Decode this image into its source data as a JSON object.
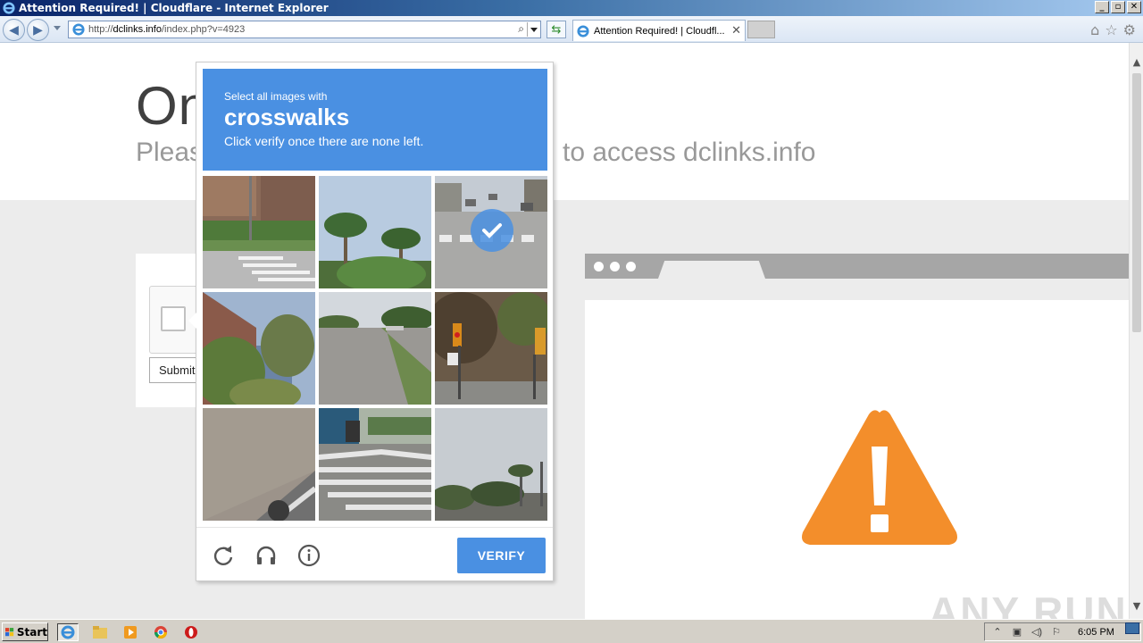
{
  "window": {
    "title": "Attention Required! | Cloudflare - Internet Explorer",
    "controls": {
      "minimize": "_",
      "restore": "▫",
      "close": "✕"
    }
  },
  "navbar": {
    "address_scheme": "http://",
    "address_host": "dclinks.info",
    "address_path": "/index.php?v=4923",
    "tab_title": "Attention Required! | Cloudfl...",
    "tab_close": "✕",
    "icons": [
      "back-icon",
      "forward-icon",
      "home-icon",
      "favorites-star-icon",
      "tools-gear-icon"
    ]
  },
  "page": {
    "heading": "On",
    "subheading_left": "Pleas",
    "subheading_right": "to access dclinks.info",
    "submit_label": "Submit"
  },
  "captcha": {
    "prompt_small": "Select all images with",
    "prompt_target": "crosswalks",
    "prompt_note": "Click verify once there are none left.",
    "verify_label": "VERIFY",
    "tiles": [
      {
        "name": "tile-1-sidewalk-crosswalk",
        "selected": false
      },
      {
        "name": "tile-2-palm-trees",
        "selected": false
      },
      {
        "name": "tile-3-street-crosswalk",
        "selected": true
      },
      {
        "name": "tile-4-palm-building",
        "selected": false
      },
      {
        "name": "tile-5-empty-road",
        "selected": false
      },
      {
        "name": "tile-6-traffic-lights",
        "selected": false
      },
      {
        "name": "tile-7-road-curb",
        "selected": false
      },
      {
        "name": "tile-8-crosswalk-stripes",
        "selected": false
      },
      {
        "name": "tile-9-trees-sky",
        "selected": false
      }
    ],
    "accent": "#4a90e2"
  },
  "watermark": "ANY RUN",
  "taskbar": {
    "start_label": "Start",
    "clock": "6:05 PM"
  }
}
